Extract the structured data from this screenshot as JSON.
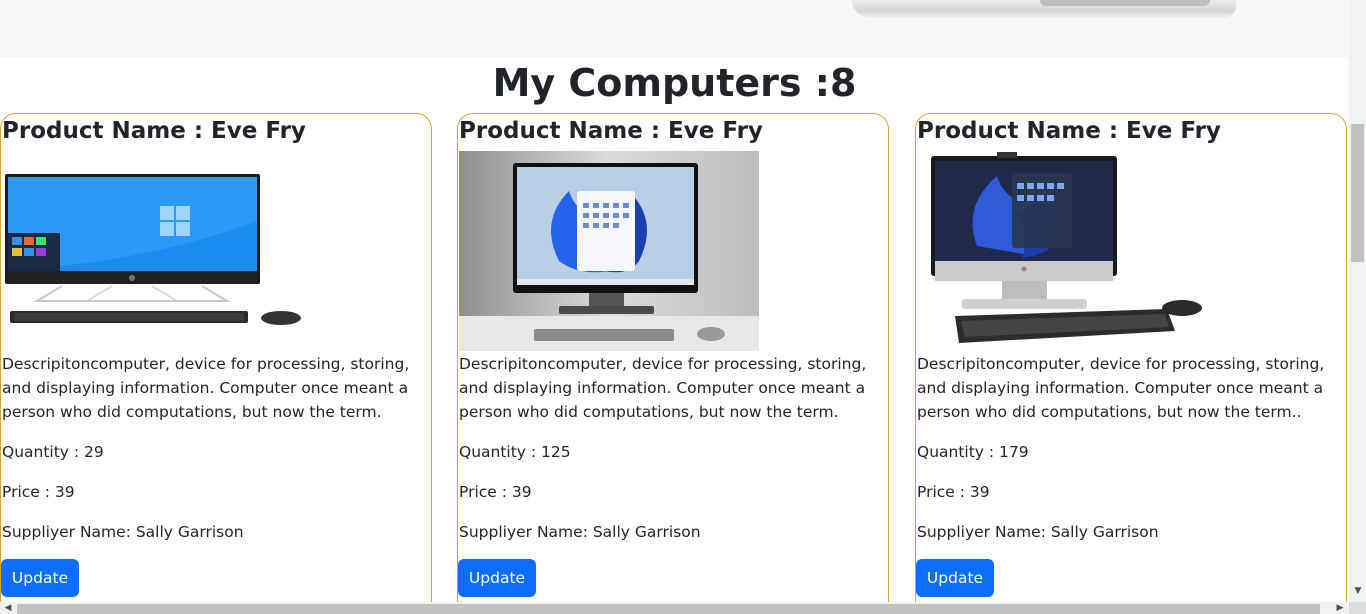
{
  "page_title": "My Computers :8",
  "products": [
    {
      "name": "Product Name : Eve Fry",
      "image": "all-in-one-computer-windows-10",
      "description": "Descripitoncomputer, device for processing, storing, and displaying information. Computer once meant a person who did computations, but now the term.",
      "quantity": "Quantity : 29",
      "price": "Price : 39",
      "supplier": "Suppliyer Name: Sally Garrison",
      "button": "Update"
    },
    {
      "name": "Product Name : Eve Fry",
      "image": "desktop-monitor-windows-11",
      "description": "Descripitoncomputer, device for processing, storing, and displaying information. Computer once meant a person who did computations, but now the term.",
      "quantity": "Quantity : 125",
      "price": "Price : 39",
      "supplier": "Suppliyer Name: Sally Garrison",
      "button": "Update"
    },
    {
      "name": "Product Name : Eve Fry",
      "image": "all-in-one-computer-windows-11",
      "description": "Descripitoncomputer, device for processing, storing, and displaying information. Computer once meant a person who did computations, but now the term..",
      "quantity": "Quantity : 179",
      "price": "Price : 39",
      "supplier": "Suppliyer Name: Sally Garrison",
      "button": "Update"
    }
  ],
  "colors": {
    "accent": "#0d6efd",
    "card_border": "#d9a52c",
    "text": "#212529"
  }
}
